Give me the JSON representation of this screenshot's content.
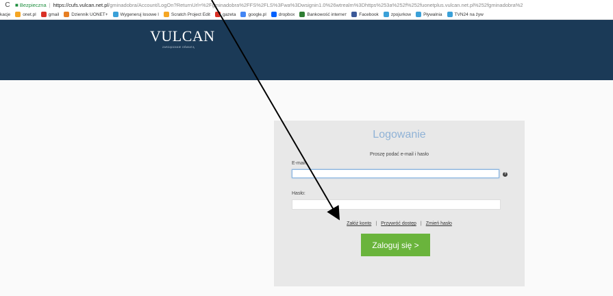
{
  "browser": {
    "secure_label": "Bezpieczna",
    "url_host": "https://cufs.vulcan.net.pl",
    "url_rest": "/gminadobra/Account/LogOn?ReturnUrl=%2Fgminadobra%2FFS%2FLS%3Fwa%3Dwsignin1.0%26wtrealm%3Dhttps%253a%252f%252fuonetplus.vulcan.net.pl%252fgminadobra%2",
    "bookmarks": [
      {
        "label": "kacje",
        "color": "#ffffff"
      },
      {
        "label": "onet.pl",
        "color": "#f5a623"
      },
      {
        "label": "gmail",
        "color": "#d93025"
      },
      {
        "label": "Dziennik UONET+",
        "color": "#e67e22"
      },
      {
        "label": "Wygeneruj losowe l",
        "color": "#3aa0d8"
      },
      {
        "label": "Scratch Project Edit",
        "color": "#f5a623"
      },
      {
        "label": "gazeta",
        "color": "#d93025"
      },
      {
        "label": "google.pl",
        "color": "#4285f4"
      },
      {
        "label": "dropbox",
        "color": "#0061fe"
      },
      {
        "label": "Bankowość interneт",
        "color": "#2e7d32"
      },
      {
        "label": "Facebook",
        "color": "#3b5998"
      },
      {
        "label": "zpojurkow",
        "color": "#3aa0d8"
      },
      {
        "label": "Pływalnia",
        "color": "#3aa0d8"
      },
      {
        "label": "TVN24 na żyw",
        "color": "#3aa0d8"
      }
    ]
  },
  "header": {
    "logo_text": "VULCAN",
    "logo_sub": "ZARZĄDZANIE OŚWIATĄ",
    "bg_color": "#1b3a57"
  },
  "login": {
    "title": "Logowanie",
    "subtitle": "Proszę podać e-mail i hasło",
    "email_label": "E-mail:",
    "email_value": "",
    "password_label": "Hasło:",
    "password_value": "",
    "help_icon": "question-icon",
    "links": {
      "create_account": "Załóż konto",
      "restore_access": "Przywróć dostęp",
      "change_password": "Zmień hasło"
    },
    "submit_label": "Zaloguj się >",
    "button_color": "#6ab43c"
  }
}
